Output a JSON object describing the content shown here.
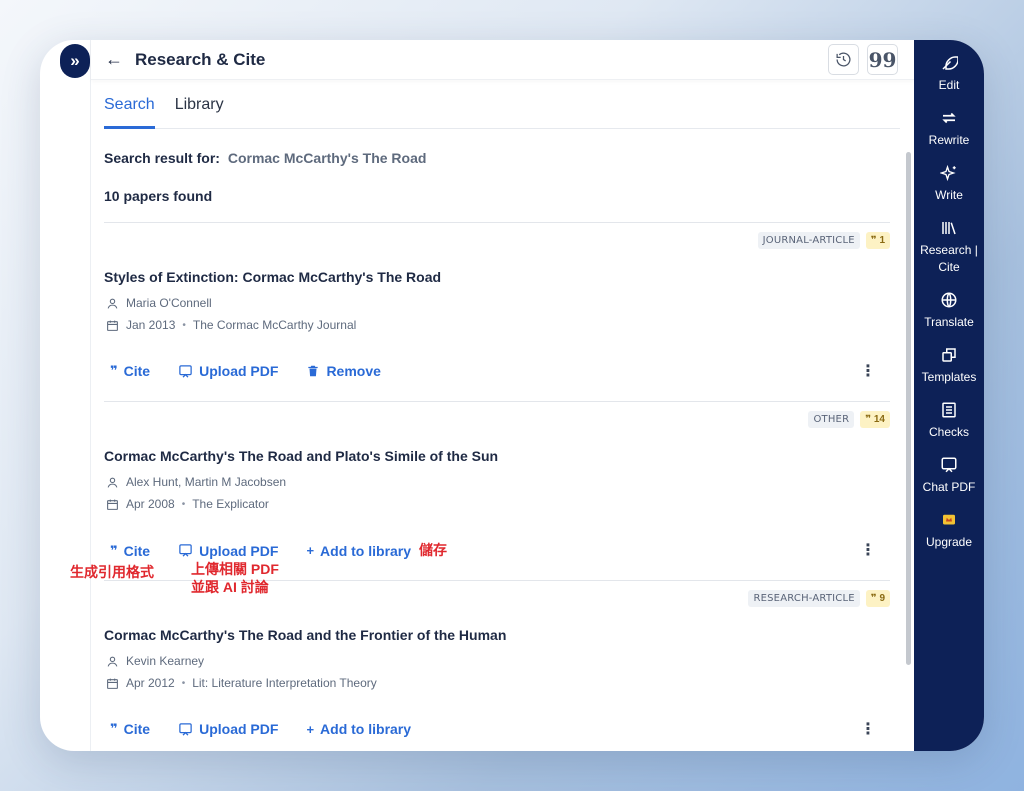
{
  "header": {
    "title": "Research & Cite",
    "back_icon": "arrow-left-icon"
  },
  "tabs": [
    {
      "label": "Search",
      "active": true
    },
    {
      "label": "Library",
      "active": false
    }
  ],
  "search": {
    "label": "Search result for:",
    "query": "Cormac McCarthy's The Road"
  },
  "count_text": "10 papers found",
  "papers": [
    {
      "type": "JOURNAL-ARTICLE",
      "citations": "1",
      "title": "Styles of Extinction: Cormac McCarthy's The Road",
      "authors": "Maria O'Connell",
      "date": "Jan 2013",
      "venue": "The Cormac McCarthy Journal",
      "actions": [
        "Cite",
        "Upload PDF",
        "Remove"
      ]
    },
    {
      "type": "OTHER",
      "citations": "14",
      "title": "Cormac McCarthy's The Road and Plato's Simile of the Sun",
      "authors": "Alex Hunt, Martin M Jacobsen",
      "date": "Apr 2008",
      "venue": "The Explicator",
      "actions": [
        "Cite",
        "Upload PDF",
        "Add to library"
      ]
    },
    {
      "type": "RESEARCH-ARTICLE",
      "citations": "9",
      "title": "Cormac McCarthy's The Road and the Frontier of the Human",
      "authors": "Kevin Kearney",
      "date": "Apr 2012",
      "venue": "Lit: Literature Interpretation Theory",
      "actions": [
        "Cite",
        "Upload PDF",
        "Add to library"
      ]
    }
  ],
  "annotations": {
    "cite": "生成引用格式",
    "upload_line1": "上傳相關 PDF",
    "upload_line2": "並跟 AI 討論",
    "save": "儲存"
  },
  "sidebar": [
    {
      "label": "Edit",
      "icon": "feather-icon"
    },
    {
      "label": "Rewrite",
      "icon": "repeat-icon"
    },
    {
      "label": "Write",
      "icon": "sparkles-icon"
    },
    {
      "label": "Research | Cite",
      "icon": "books-icon"
    },
    {
      "label": "Translate",
      "icon": "globe-icon"
    },
    {
      "label": "Templates",
      "icon": "copy-icon"
    },
    {
      "label": "Checks",
      "icon": "checklist-icon"
    },
    {
      "label": "Chat PDF",
      "icon": "chat-icon"
    },
    {
      "label": "Upgrade",
      "icon": "crown-icon"
    }
  ],
  "colors": {
    "accent": "#2a6ad6",
    "sidebar_bg": "#0d2157",
    "annotation": "#e0282e",
    "cite_badge_bg": "#fdf2c4"
  }
}
